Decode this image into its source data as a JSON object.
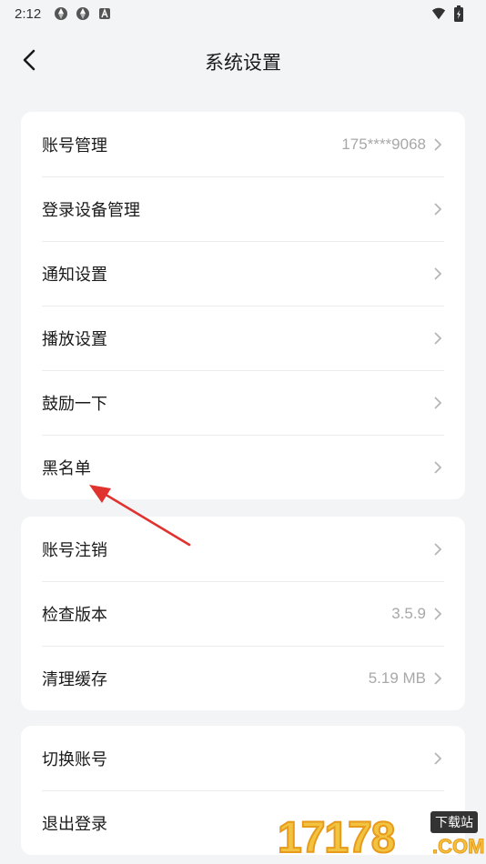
{
  "status_bar": {
    "time": "2:12",
    "icons": [
      "aperture-icon",
      "aperture-icon",
      "text-a-icon"
    ],
    "right_icons": [
      "wifi-icon",
      "battery-icon"
    ]
  },
  "header": {
    "title": "系统设置",
    "back_icon": "chevron-left-icon"
  },
  "groups": [
    {
      "items": [
        {
          "label": "账号管理",
          "value": "175****9068"
        },
        {
          "label": "登录设备管理",
          "value": ""
        },
        {
          "label": "通知设置",
          "value": ""
        },
        {
          "label": "播放设置",
          "value": ""
        },
        {
          "label": "鼓励一下",
          "value": ""
        },
        {
          "label": "黑名单",
          "value": ""
        }
      ]
    },
    {
      "items": [
        {
          "label": "账号注销",
          "value": ""
        },
        {
          "label": "检查版本",
          "value": "3.5.9"
        },
        {
          "label": "清理缓存",
          "value": "5.19 MB"
        }
      ]
    },
    {
      "items": [
        {
          "label": "切换账号",
          "value": ""
        },
        {
          "label": "退出登录",
          "value": ""
        }
      ]
    }
  ],
  "watermark": {
    "digits": "17178",
    "tag": "下载站",
    "suffix": ".COM"
  },
  "colors": {
    "background": "#f3f4f6",
    "card": "#ffffff",
    "annotation_arrow": "#e0322e",
    "watermark": "#f2c341"
  }
}
